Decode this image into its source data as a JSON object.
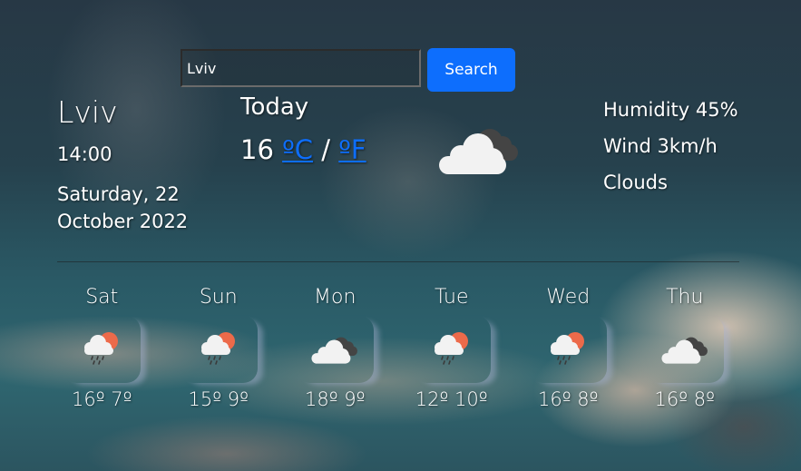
{
  "search": {
    "value": "Lviv",
    "button_label": "Search"
  },
  "current": {
    "city": "Lviv",
    "time": "14:00",
    "date": "Saturday, 22 October 2022",
    "today_label": "Today",
    "temperature": "16",
    "unit_celsius": "ºC",
    "unit_separator": "/",
    "unit_fahrenheit": "ºF",
    "icon": "cloudy-icon",
    "humidity": "Humidity 45%",
    "wind": "Wind 3km/h",
    "description": "Clouds"
  },
  "colors": {
    "accent": "#0d6efd",
    "sun": "#ec6a4a",
    "cloud_light": "#f2f2f2",
    "cloud_dark": "#444444"
  },
  "forecast": [
    {
      "day": "Sat",
      "icon": "rain-sun-icon",
      "temps": "16º 7º"
    },
    {
      "day": "Sun",
      "icon": "rain-sun-icon",
      "temps": "15º 9º"
    },
    {
      "day": "Mon",
      "icon": "cloudy-icon",
      "temps": "18º 9º"
    },
    {
      "day": "Tue",
      "icon": "rain-sun-icon",
      "temps": "12º 10º"
    },
    {
      "day": "Wed",
      "icon": "rain-sun-icon",
      "temps": "16º 8º"
    },
    {
      "day": "Thu",
      "icon": "cloudy-icon",
      "temps": "16º 8º"
    }
  ]
}
